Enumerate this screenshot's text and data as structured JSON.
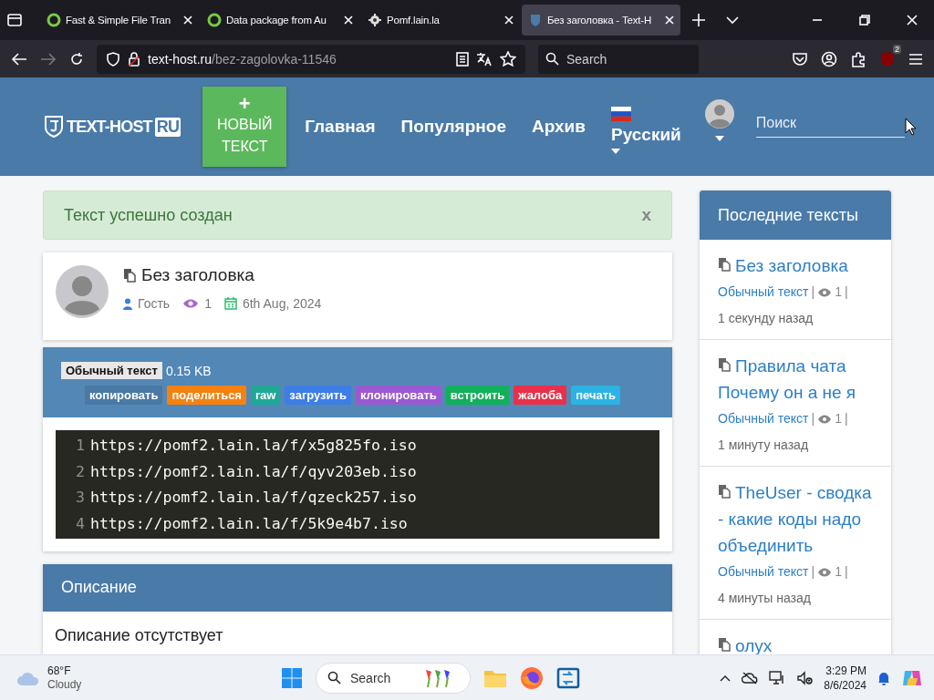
{
  "browser": {
    "tabs": [
      {
        "title": "Fast & Simple File Tran",
        "kind": "ring",
        "selected": false
      },
      {
        "title": "Data package from Au",
        "kind": "ring",
        "selected": false
      },
      {
        "title": "Pomf.lain.la",
        "kind": "gear",
        "selected": false
      },
      {
        "title": "Без заголовка - Text-H",
        "kind": "shield",
        "selected": true
      }
    ],
    "url": {
      "host": "text-host.ru",
      "path": "/bez-zagolovka-11546"
    },
    "search_placeholder": "Search",
    "extension_badge": "2"
  },
  "header": {
    "logo": {
      "name": "TEXT-HOST",
      "suffix": "RU"
    },
    "new_button": {
      "icon": "+",
      "label": "НОВЫЙ ТЕКСТ"
    },
    "nav": [
      "Главная",
      "Популярное",
      "Архив"
    ],
    "language": "Русский",
    "search_placeholder": "Поиск"
  },
  "alert": {
    "text": "Текст успешно создан",
    "close": "x"
  },
  "paste": {
    "title": "Без заголовка",
    "author": "Гость",
    "views": "1",
    "date": "6th Aug, 2024",
    "syntax": "Обычный текст",
    "size": "0.15 KB",
    "actions": [
      {
        "label": "копировать",
        "color": "#4a79a5"
      },
      {
        "label": "поделиться",
        "color": "#f5820f"
      },
      {
        "label": "raw",
        "color": "#1fa896"
      },
      {
        "label": "загрузить",
        "color": "#3d7ee6"
      },
      {
        "label": "клонировать",
        "color": "#9b59d1"
      },
      {
        "label": "встроить",
        "color": "#12b05a"
      },
      {
        "label": "жалоба",
        "color": "#e8304a"
      },
      {
        "label": "печать",
        "color": "#2ab3e3"
      }
    ],
    "lines": [
      {
        "number": "1",
        "text": "https://pomf2.lain.la/f/x5g825fo.iso"
      },
      {
        "number": "2",
        "text": "https://pomf2.lain.la/f/qyv203eb.iso"
      },
      {
        "number": "3",
        "text": "https://pomf2.lain.la/f/qzeck257.iso"
      },
      {
        "number": "4",
        "text": "https://pomf2.lain.la/f/5k9e4b7.iso"
      }
    ]
  },
  "description": {
    "title": "Описание",
    "text": "Описание отсутствует"
  },
  "sidebar": {
    "title": "Последние тексты",
    "items": [
      {
        "title": "Без заголовка",
        "syntax": "Обычный текст",
        "separator_before": "|",
        "views": "1",
        "separator_after": "|",
        "time": "1 секунду назад"
      },
      {
        "title": "Правила чата Почему он а не я",
        "syntax": "Обычный текст",
        "separator_before": "|",
        "views": "1",
        "separator_after": "|",
        "time": "1 минуту назад"
      },
      {
        "title": "TheUser - сводка - какие коды надо объединить",
        "syntax": "Обычный текст",
        "separator_before": "|",
        "views": "1",
        "separator_after": "|",
        "time": "4 минуты назад"
      },
      {
        "title": "олух"
      }
    ]
  },
  "taskbar": {
    "weather": {
      "temperature": "68°F",
      "condition": "Cloudy"
    },
    "search_placeholder": "Search",
    "time": "3:29 PM",
    "date": "8/6/2024"
  }
}
